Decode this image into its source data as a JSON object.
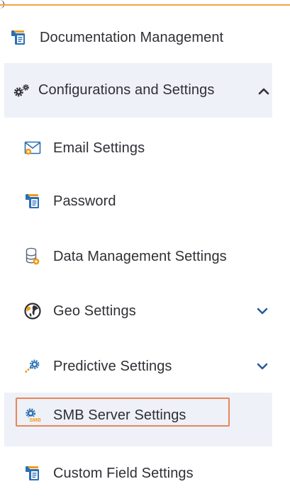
{
  "menu": {
    "items": [
      {
        "label": "Documentation Management",
        "icon": "documentation-icon"
      },
      {
        "label": "Configurations and Settings",
        "icon": "gears-icon",
        "expanded": true
      },
      {
        "label": "Email Settings",
        "icon": "email-settings-icon"
      },
      {
        "label": "Password",
        "icon": "password-icon"
      },
      {
        "label": "Data Management Settings",
        "icon": "database-settings-icon"
      },
      {
        "label": "Geo Settings",
        "icon": "globe-icon",
        "expanded": false
      },
      {
        "label": "Predictive Settings",
        "icon": "predictive-icon",
        "expanded": false
      },
      {
        "label": "SMB Server Settings",
        "icon": "smb-server-icon",
        "selected": true
      },
      {
        "label": "Custom Field Settings",
        "icon": "custom-field-icon"
      }
    ]
  },
  "colors": {
    "accent_rule": "#f7a23b",
    "selected_bg": "#eef1f7",
    "highlight_border": "#e8855a",
    "icon_blue": "#2a6fb3",
    "icon_orange": "#f39c12",
    "text": "#2f3035"
  }
}
